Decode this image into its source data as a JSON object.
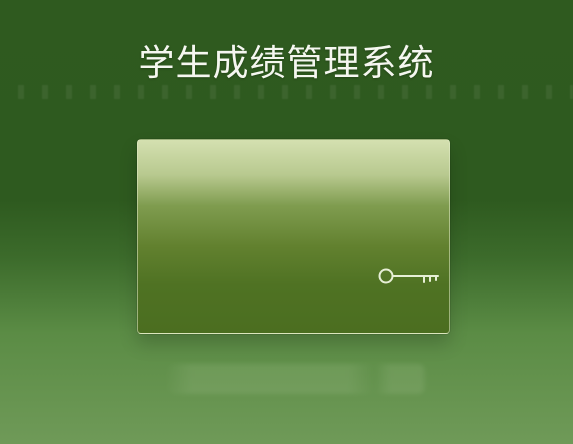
{
  "header": {
    "title": "学生成绩管理系统"
  },
  "panel": {
    "icon": "key-icon"
  },
  "colors": {
    "background_top": "#2f5a1f",
    "background_bottom": "#6f9a58",
    "panel_top": "#d4e0b0",
    "panel_bottom": "#4b6e20",
    "title_text": "#f5f7f0"
  }
}
